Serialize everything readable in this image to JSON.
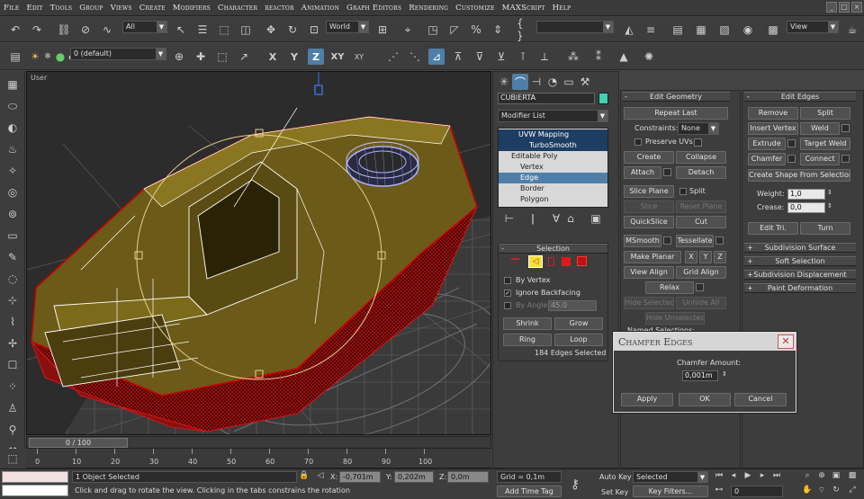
{
  "menu": [
    "File",
    "Edit",
    "Tools",
    "Group",
    "Views",
    "Create",
    "Modifiers",
    "Character",
    "reactor",
    "Animation",
    "Graph Editors",
    "Rendering",
    "Customize",
    "MAXScript",
    "Help"
  ],
  "toolbar1": {
    "selection_filter": "All",
    "ref_coord": "World",
    "named_sel": "",
    "view_sel": "View"
  },
  "toolbar2": {
    "layer": "0 (default)",
    "axis_x": "X",
    "axis_y": "Y",
    "axis_z": "Z",
    "axis_xy": "XY",
    "axis_xy_small": "XY"
  },
  "viewport": {
    "label": "User"
  },
  "object_name": "CUBIERTA",
  "object_color": "#3fd3b0",
  "modifier_list": "Modifier List",
  "stack": [
    {
      "label": "UVW Mapping"
    },
    {
      "label": "TurboSmooth"
    },
    {
      "label": "Editable Poly"
    },
    {
      "label": "Vertex"
    },
    {
      "label": "Edge"
    },
    {
      "label": "Border"
    },
    {
      "label": "Polygon"
    }
  ],
  "selection": {
    "title": "Selection",
    "by_vertex": "By Vertex",
    "ignore_backfacing": "Ignore Backfacing",
    "by_angle": "By Angle:",
    "angle_value": "45.0",
    "shrink": "Shrink",
    "grow": "Grow",
    "ring": "Ring",
    "loop": "Loop",
    "status": "184 Edges Selected"
  },
  "edit_geometry": {
    "title": "Edit Geometry",
    "repeat_last": "Repeat Last",
    "constraints_label": "Constraints:",
    "constraints_value": "None",
    "preserve_uvs": "Preserve UVs",
    "create": "Create",
    "collapse": "Collapse",
    "attach": "Attach",
    "detach": "Detach",
    "slice_plane": "Slice Plane",
    "split": "Split",
    "slice": "Slice",
    "reset_plane": "Reset Plane",
    "quickslice": "QuickSlice",
    "cut": "Cut",
    "msmooth": "MSmooth",
    "tessellate": "Tessellate",
    "make_planar": "Make Planar",
    "x": "X",
    "y": "Y",
    "z": "Z",
    "view_align": "View Align",
    "grid_align": "Grid Align",
    "relax": "Relax",
    "hide_selected": "Hide Selected",
    "unhide_all": "Unhide All",
    "hide_unselected": "Hide Unselected",
    "named_selections": "Named Selections:"
  },
  "edit_edges": {
    "title": "Edit Edges",
    "remove": "Remove",
    "split": "Split",
    "insert_vertex": "Insert Vertex",
    "weld": "Weld",
    "extrude": "Extrude",
    "target_weld": "Target Weld",
    "chamfer": "Chamfer",
    "connect": "Connect",
    "create_shape": "Create Shape From Selection",
    "weight_label": "Weight:",
    "weight_value": "1,0",
    "crease_label": "Crease:",
    "crease_value": "0,0",
    "edit_tri": "Edit Tri.",
    "turn": "Turn"
  },
  "rollouts": [
    "Subdivision Surface",
    "Soft Selection",
    "Subdivision Displacement",
    "Paint Deformation"
  ],
  "chamfer_dialog": {
    "title": "Chamfer Edges",
    "amount_label": "Chamfer Amount:",
    "amount_value": "0,001m",
    "apply": "Apply",
    "ok": "OK",
    "cancel": "Cancel"
  },
  "timeline": {
    "slider": "0 / 100",
    "ticks": [
      "0",
      "10",
      "20",
      "30",
      "40",
      "50",
      "60",
      "70",
      "80",
      "90",
      "100"
    ]
  },
  "status": {
    "objects": "1 Object Selected",
    "prompt": "Click and drag to rotate the view.  Clicking in the tabs constrains the rotation",
    "x_label": "X:",
    "x_value": "-0,701m",
    "y_label": "Y:",
    "y_value": "0,202m",
    "z_label": "Z:",
    "z_value": "0,0m",
    "grid": "Grid = 0,1m",
    "add_time_tag": "Add Time Tag",
    "auto_key": "Auto Key",
    "set_key": "Set Key",
    "key_mode": "Selected",
    "key_filters": "Key Filters...",
    "frame": "0"
  }
}
